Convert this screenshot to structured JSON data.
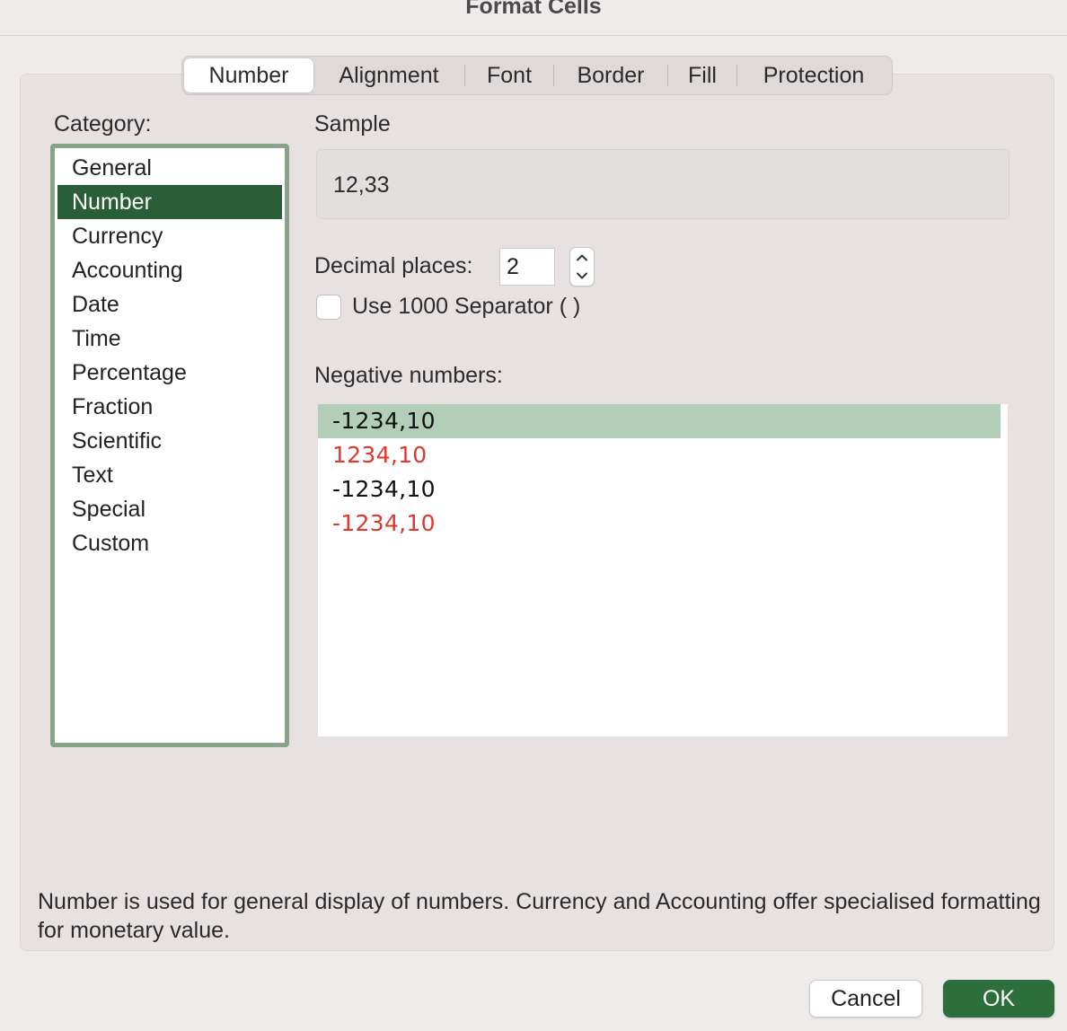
{
  "window": {
    "title": "Format Cells"
  },
  "tabs": [
    {
      "label": "Number",
      "active": true
    },
    {
      "label": "Alignment",
      "active": false
    },
    {
      "label": "Font",
      "active": false
    },
    {
      "label": "Border",
      "active": false
    },
    {
      "label": "Fill",
      "active": false
    },
    {
      "label": "Protection",
      "active": false
    }
  ],
  "category": {
    "label": "Category:",
    "items": [
      "General",
      "Number",
      "Currency",
      "Accounting",
      "Date",
      "Time",
      "Percentage",
      "Fraction",
      "Scientific",
      "Text",
      "Special",
      "Custom"
    ],
    "selected": "Number"
  },
  "sample": {
    "label": "Sample",
    "value": "12,33"
  },
  "decimal_places": {
    "label": "Decimal places:",
    "value": "2"
  },
  "separator": {
    "label": "Use 1000 Separator ( )",
    "checked": false
  },
  "negative_numbers": {
    "label": "Negative numbers:",
    "items": [
      {
        "text": "-1234,10",
        "color": "#111111",
        "selected": true
      },
      {
        "text": "1234,10",
        "color": "#e0362c",
        "selected": false
      },
      {
        "text": "-1234,10",
        "color": "#111111",
        "selected": false
      },
      {
        "text": "-1234,10",
        "color": "#e0362c",
        "selected": false
      }
    ]
  },
  "description": "Number is used for general display of numbers.  Currency and Accounting offer specialised formatting for monetary value.",
  "buttons": {
    "cancel": "Cancel",
    "ok": "OK"
  },
  "colors": {
    "accent": "#2d6e3d",
    "category_selected": "#2a5e36",
    "negative_selected": "#b3ceb7",
    "list_border": "#87a38a",
    "negative_red": "#e0362c"
  }
}
